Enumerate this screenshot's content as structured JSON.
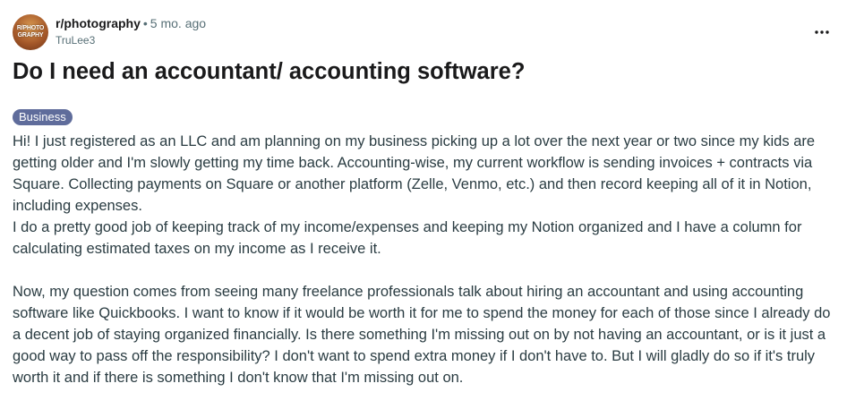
{
  "post": {
    "subreddit": "r/photography",
    "separator": "•",
    "age": "5 mo. ago",
    "author": "TruLee3",
    "avatar_text_line1": "R/PHOTO",
    "avatar_text_line2": "GRAPHY",
    "title": "Do I need an accountant/ accounting software?",
    "flair": "Business",
    "flair_color": "#5f6c9b",
    "overflow_icon": "more-horizontal-icon",
    "body_paragraph_1_line_1": "Hi! I just registered as an LLC and am planning on my business picking up a lot over the next year or two since my kids are getting older and I'm slowly getting my time back. Accounting-wise, my current workflow is sending invoices + contracts via Square. Collecting payments on Square or another platform (Zelle, Venmo, etc.) and then record keeping all of it in Notion, including expenses.",
    "body_paragraph_1_line_2": "I do a pretty good job of keeping track of my income/expenses and keeping my Notion organized and I have a column for calculating estimated taxes on my income as I receive it.",
    "body_paragraph_2": "Now, my question comes from seeing many freelance professionals talk about hiring an accountant and using accounting software like Quickbooks. I want to know if it would be worth it for me to spend the money for each of those since I already do a decent job of staying organized financially. Is there something I'm missing out on by not having an accountant, or is it just a good way to pass off the responsibility? I don't want to spend extra money if I don't have to. But I will gladly do so if it's truly worth it and if there is something I don't know that I'm missing out on."
  }
}
